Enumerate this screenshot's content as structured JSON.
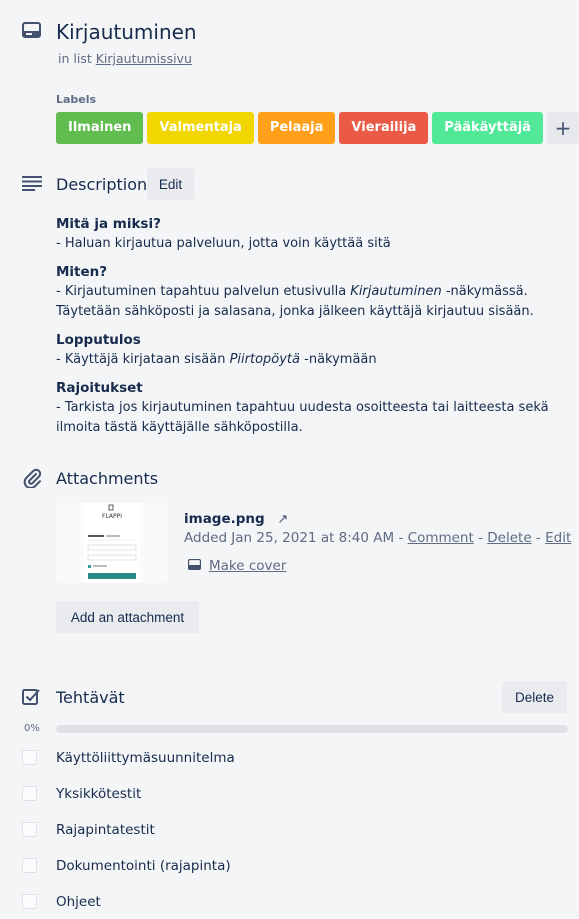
{
  "card": {
    "title": "Kirjautuminen",
    "in_list_prefix": "in list",
    "list_name": "Kirjautumissivu"
  },
  "labels": {
    "title": "Labels",
    "items": [
      {
        "text": "Ilmainen",
        "color": "#61bd4f"
      },
      {
        "text": "Valmentaja",
        "color": "#f2d600"
      },
      {
        "text": "Pelaaja",
        "color": "#ff9f1a"
      },
      {
        "text": "Vierailija",
        "color": "#eb5a46"
      },
      {
        "text": "Pääkäyttäjä",
        "color": "#51e898"
      }
    ],
    "add_symbol": "+"
  },
  "description": {
    "title": "Description",
    "edit_label": "Edit",
    "sections": [
      {
        "heading": "Mitä ja miksi?",
        "before": "- Haluan kirjautua palveluun, jotta voin käyttää sitä",
        "em": "",
        "after": ""
      },
      {
        "heading": "Miten?",
        "before": "- Kirjautuminen tapahtuu palvelun etusivulla ",
        "em": "Kirjautuminen",
        "after": " -näkymässä. Täytetään sähköposti ja salasana, jonka jälkeen käyttäjä kirjautuu sisään."
      },
      {
        "heading": "Lopputulos",
        "before": "- Käyttäjä kirjataan sisään ",
        "em": "Piirtopöytä",
        "after": " -näkymään"
      },
      {
        "heading": "Rajoitukset",
        "before": "- Tarkista jos kirjautuminen tapahtuu uudesta osoitteesta tai laitteesta sekä ilmoita tästä käyttäjälle sähköpostilla.",
        "em": "",
        "after": ""
      }
    ]
  },
  "attachments": {
    "title": "Attachments",
    "file": {
      "name": "image.png",
      "open_icon": "↗",
      "added": "Added Jan 25, 2021 at 8:40 AM",
      "sep": " - ",
      "comment": "Comment",
      "delete": "Delete",
      "edit": "Edit",
      "make_cover": "Make cover",
      "thumb_brand": "FLAPPI"
    },
    "add_label": "Add an attachment"
  },
  "checklist": {
    "title": "Tehtävät",
    "delete_label": "Delete",
    "progress_text": "0%",
    "progress_value": 0,
    "items": [
      {
        "text": "Käyttöliittymäsuunnitelma",
        "checked": false
      },
      {
        "text": "Yksikkötestit",
        "checked": false
      },
      {
        "text": "Rajapintatestit",
        "checked": false
      },
      {
        "text": "Dokumentointi (rajapinta)",
        "checked": false
      },
      {
        "text": "Ohjeet",
        "checked": false
      }
    ]
  }
}
